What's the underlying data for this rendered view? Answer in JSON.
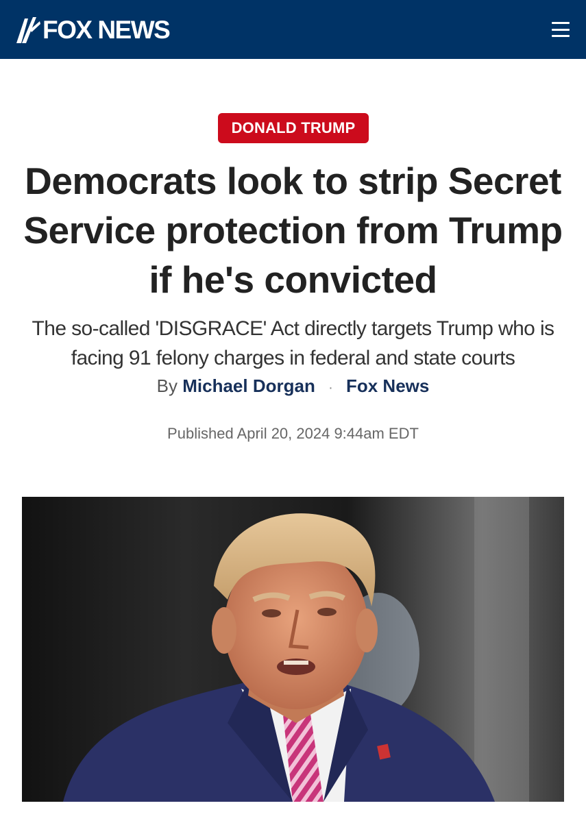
{
  "header": {
    "logo_text": "FOX NEWS",
    "logo_icon": "fox-news-searchlight-icon",
    "menu_icon": "hamburger-menu-icon",
    "background_color": "#003366"
  },
  "article": {
    "category": "DONALD TRUMP",
    "category_color": "#cc0b1c",
    "headline": "Democrats look to strip Secret Service protection from Trump if he's convicted",
    "subheadline": "The so-called 'DISGRACE' Act directly targets Trump who is facing 91 felony charges in federal and state courts",
    "byline_prefix": "By",
    "author": "Michael Dorgan",
    "separator": "·",
    "outlet": "Fox News",
    "published": "Published April 20, 2024 9:44am EDT"
  }
}
